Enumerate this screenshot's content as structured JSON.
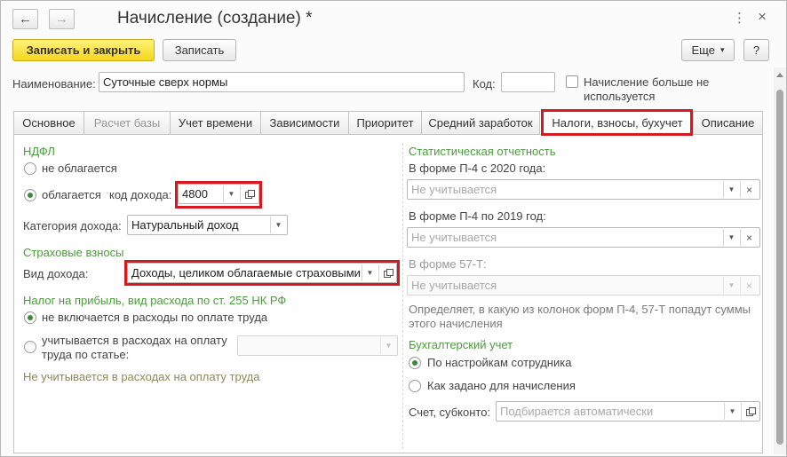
{
  "window": {
    "title": "Начисление (создание) *",
    "nav_back_icon": "←",
    "nav_forward_icon": "→",
    "menu_icon": "⋮",
    "close_icon": "×"
  },
  "toolbar": {
    "save_close_label": "Записать и закрыть",
    "save_label": "Записать",
    "more_label": "Еще",
    "more_arrow": "▾",
    "help_label": "?"
  },
  "header": {
    "name_label": "Наименование:",
    "name_value": "Суточные сверх нормы",
    "code_label": "Код:",
    "code_value": "",
    "unused_label_line1": "Начисление больше не",
    "unused_label_line2": "используется"
  },
  "tabs": [
    {
      "label": "Основное"
    },
    {
      "label": "Расчет базы"
    },
    {
      "label": "Учет времени"
    },
    {
      "label": "Зависимости"
    },
    {
      "label": "Приоритет"
    },
    {
      "label": "Средний заработок"
    },
    {
      "label": "Налоги, взносы, бухучет"
    },
    {
      "label": "Описание"
    }
  ],
  "left": {
    "ndfl_title": "НДФЛ",
    "not_taxed_label": "не облагается",
    "taxed_label": "облагается",
    "income_code_label": "код дохода:",
    "income_code_value": "4800",
    "income_category_label": "Категория дохода:",
    "income_category_value": "Натуральный доход",
    "insurance_title": "Страховые взносы",
    "income_kind_label": "Вид дохода:",
    "income_kind_value": "Доходы, целиком облагаемые страховыми",
    "profit_tax_title": "Налог на прибыль, вид расхода по ст. 255 НК РФ",
    "not_included_label": "не включается в расходы по оплате труда",
    "counted_label_line1": "учитывается в расходах на оплату",
    "counted_label_line2": "труда по статье:",
    "article_value": "",
    "not_counted_hint": "Не учитывается в расходах на оплату труда"
  },
  "right": {
    "stat_title": "Статистическая отчетность",
    "p4_2020_label": "В форме П-4 с 2020 года:",
    "p4_2020_placeholder": "Не учитывается",
    "p4_2019_label": "В форме П-4 по 2019 год:",
    "p4_2019_placeholder": "Не учитывается",
    "f57t_label": "В форме 57-Т:",
    "f57t_placeholder": "Не учитывается",
    "stat_hint_line1": "Определяет, в какую из колонок форм П-4, 57-Т попадут суммы",
    "stat_hint_line2": "этого начисления",
    "accounting_title": "Бухгалтерский учет",
    "by_employee_label": "По настройкам сотрудника",
    "as_set_label": "Как задано для начисления",
    "account_label": "Счет, субконто:",
    "account_placeholder": "Подбирается автоматически"
  },
  "colors": {
    "section_green": "#4b9b3c",
    "highlight_red": "#d51920",
    "primary_yellow": "#f5d71e"
  }
}
